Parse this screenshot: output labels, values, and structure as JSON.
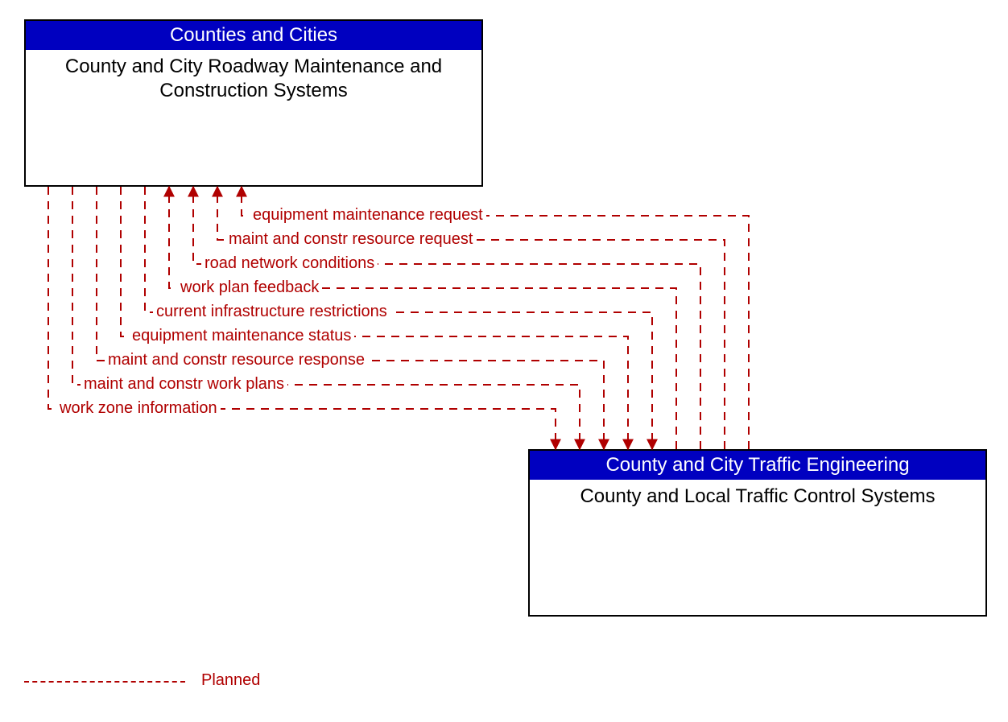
{
  "boxes": {
    "top": {
      "header": "Counties and Cities",
      "body": "County and City Roadway Maintenance and Construction Systems"
    },
    "bottom": {
      "header": "County and City Traffic Engineering",
      "body": "County and Local Traffic Control Systems"
    }
  },
  "flows": [
    "equipment maintenance request",
    "maint and constr resource request",
    "road network conditions",
    "work plan feedback",
    "current infrastructure restrictions",
    "equipment maintenance status",
    "maint and constr resource response",
    "maint and constr work plans",
    "work zone information"
  ],
  "legend": {
    "label": "Planned"
  },
  "colors": {
    "header_bg": "#0000c0",
    "flow": "#b00000"
  }
}
